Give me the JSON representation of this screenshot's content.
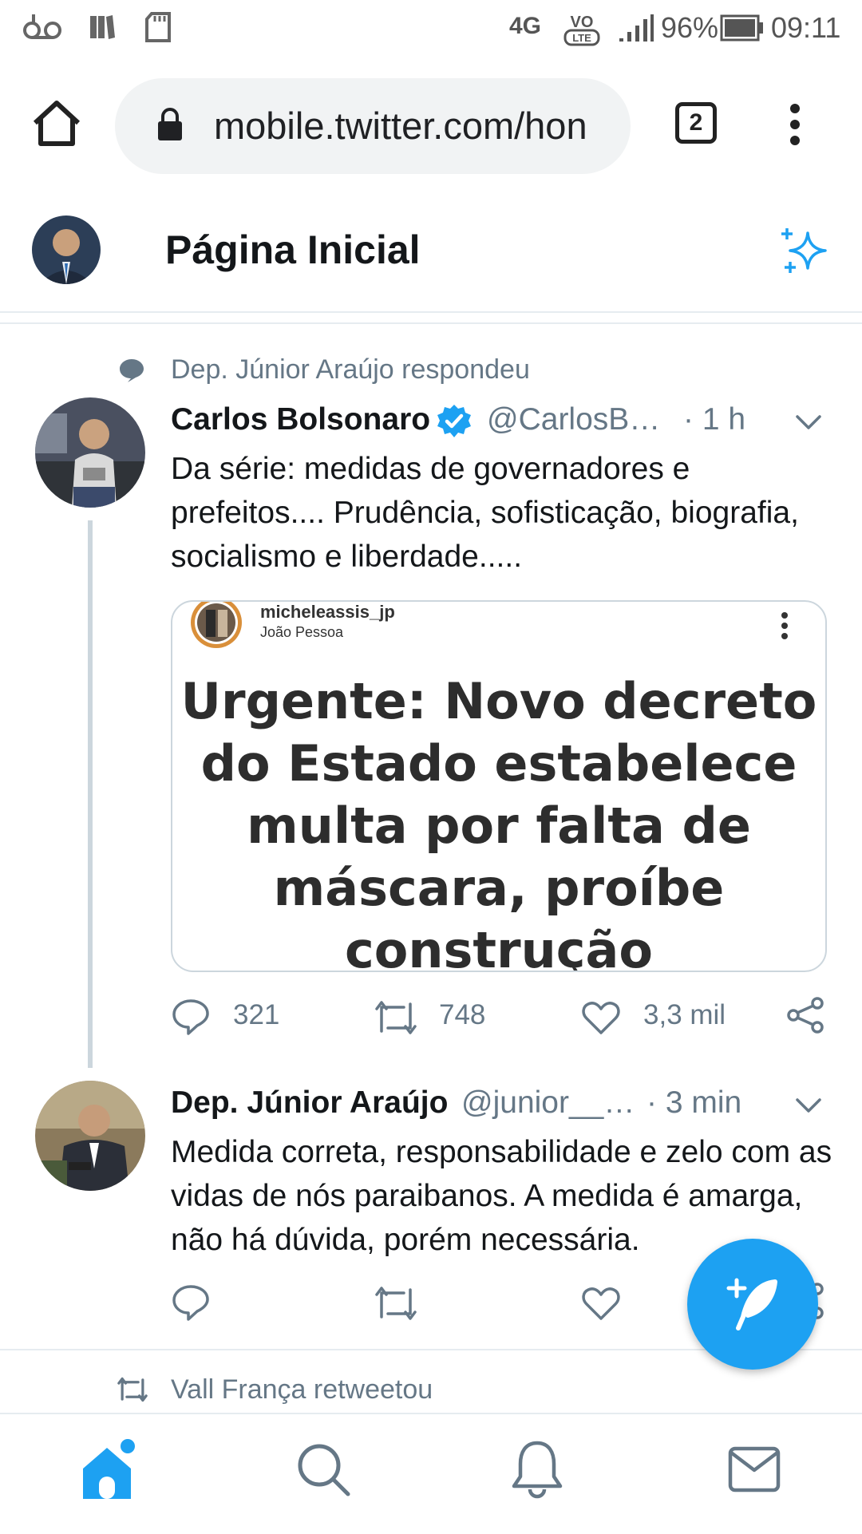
{
  "status_bar": {
    "network": "4G",
    "volte": "VO LTE",
    "battery": "96%",
    "time": "09:11"
  },
  "browser": {
    "url": "mobile.twitter.com/hon",
    "tab_count": "2",
    "icons": [
      "home-icon",
      "lock-icon",
      "tabs-icon",
      "more-vert-icon"
    ]
  },
  "header": {
    "title": "Página Inicial",
    "sparkle_icon": "sparkle-icon"
  },
  "timeline": {
    "context1": {
      "icon": "reply-bubble-icon",
      "text": "Dep. Júnior Araújo respondeu"
    },
    "tweet1": {
      "name": "Carlos Bolsonaro",
      "verified": true,
      "handle": "@CarlosB…",
      "time": "· 1 h",
      "text": "Da série: medidas de governadores e prefeitos.... Prudência, sofisticação, biografia, socialismo e liberdade.....",
      "media": {
        "username": "micheleassis_jp",
        "location": "João Pessoa",
        "headline": "Urgente: Novo decreto do Estado estabelece multa por falta de máscara, proíbe construção"
      },
      "replies": "321",
      "retweets": "748",
      "likes": "3,3 mil"
    },
    "tweet2": {
      "name": "Dep. Júnior Araújo",
      "handle": "@junior__…",
      "time": "· 3 min",
      "text": "Medida correta, responsabilidade e zelo com as vidas de nós paraibanos. A medida é amarga, não há dúvida, porém necessária."
    },
    "context2": {
      "icon": "retweet-icon",
      "text": "Vall França retweetou"
    }
  },
  "colors": {
    "accent": "#1da1f2",
    "text_primary": "#14171a",
    "text_secondary": "#657786",
    "divider": "#e6ecf0"
  }
}
